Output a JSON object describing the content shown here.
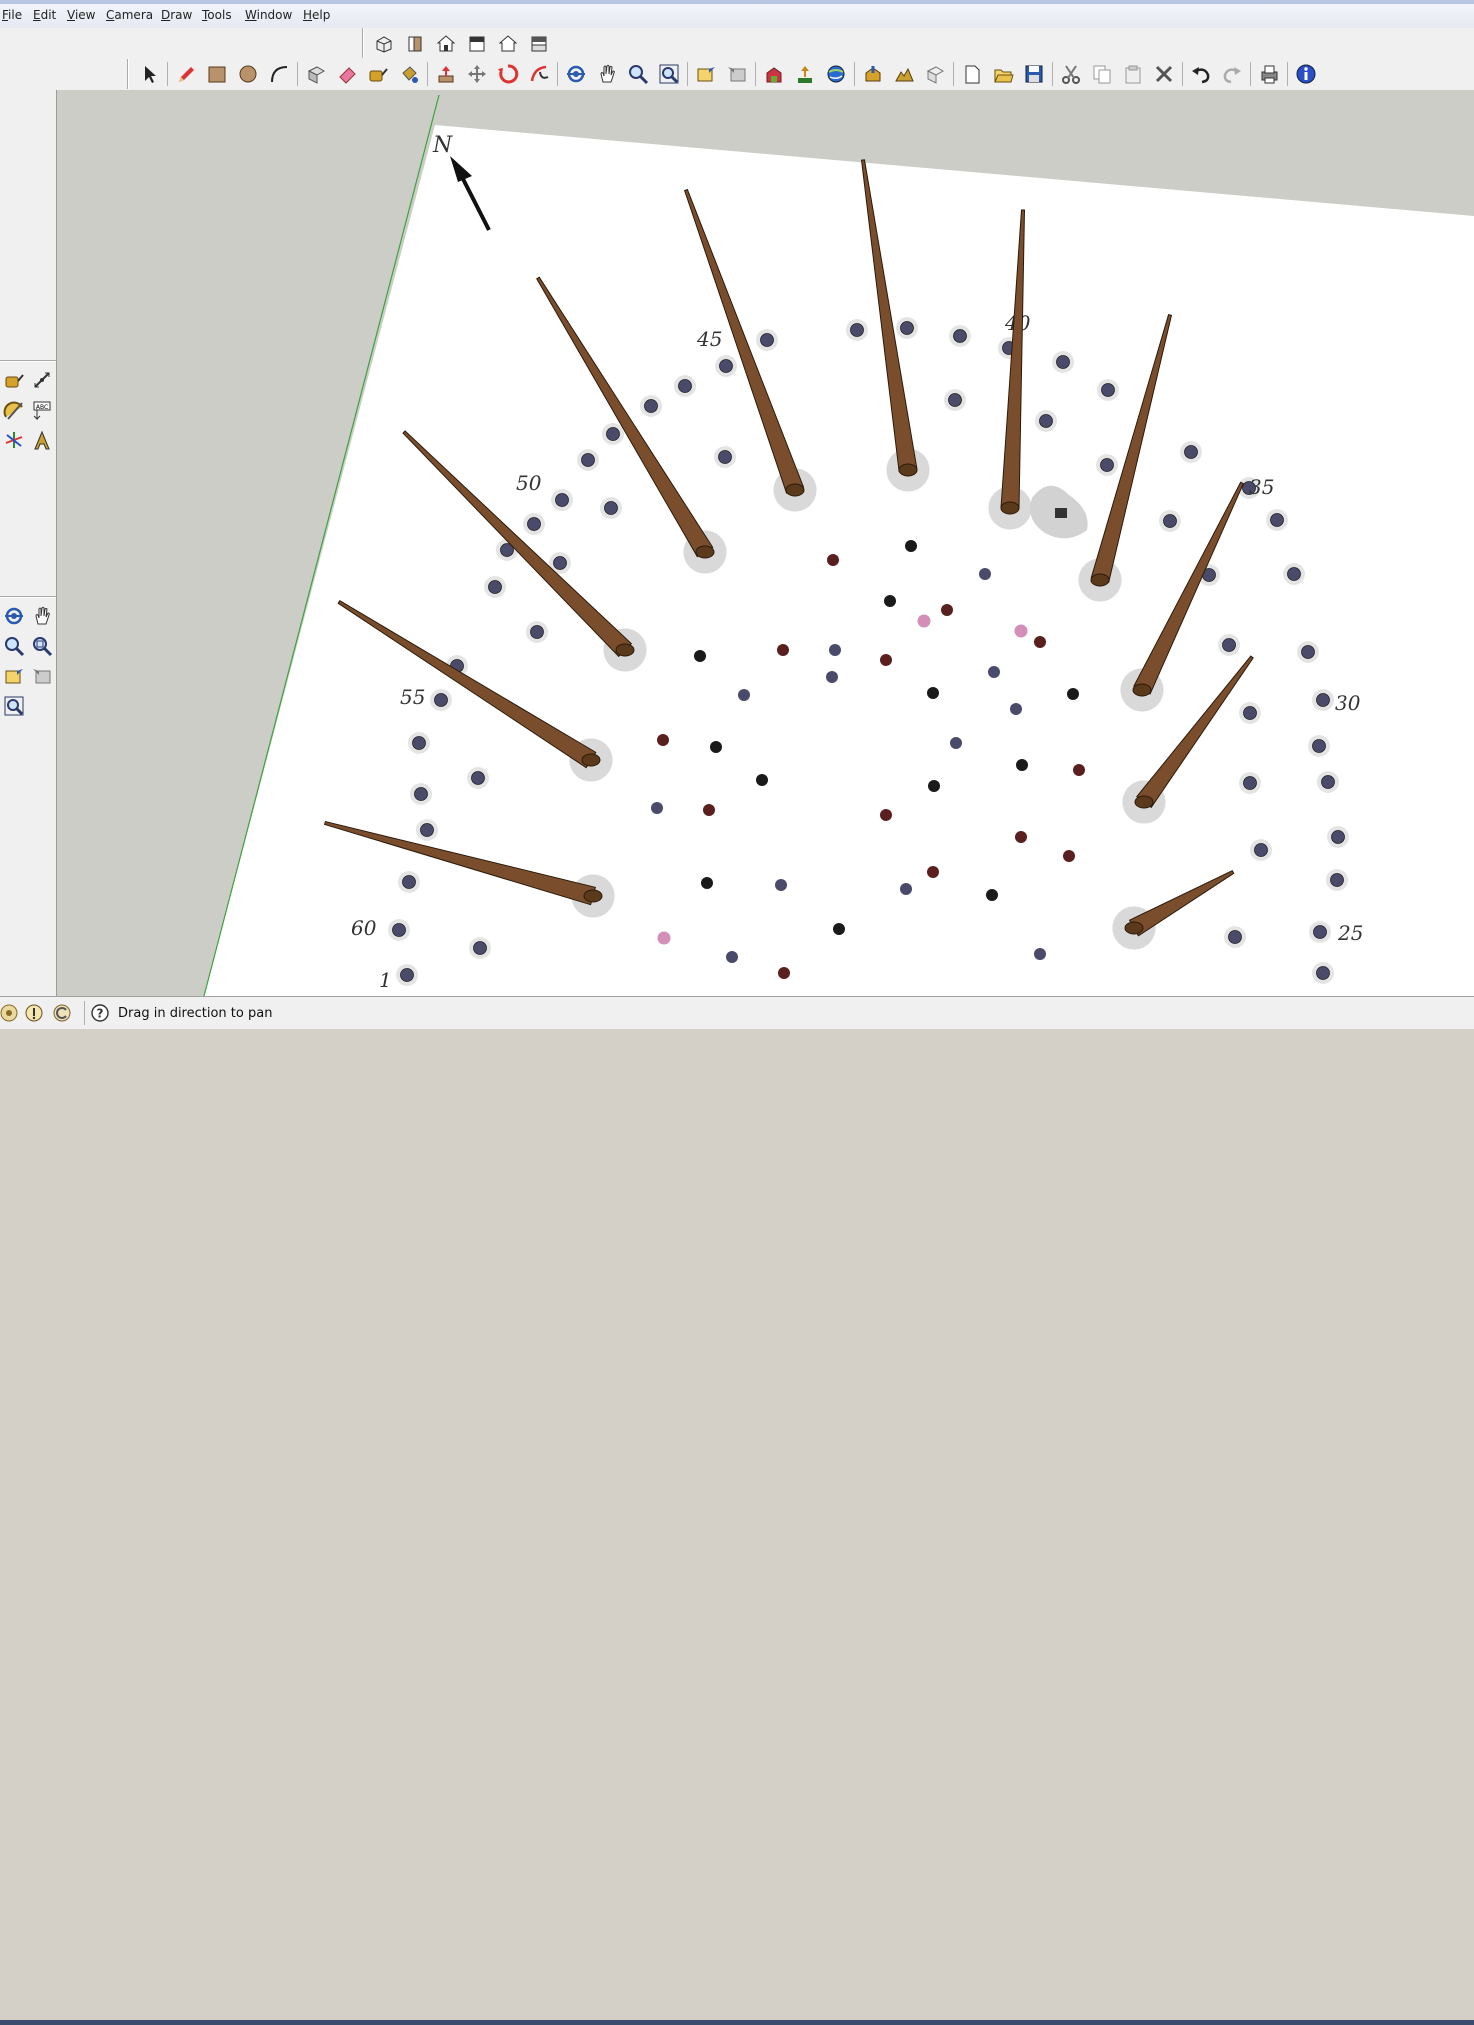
{
  "menu": {
    "items": [
      {
        "label": "File",
        "key": "F"
      },
      {
        "label": "Edit",
        "key": "E"
      },
      {
        "label": "View",
        "key": "V"
      },
      {
        "label": "Camera",
        "key": "C"
      },
      {
        "label": "Draw",
        "key": "D"
      },
      {
        "label": "Tools",
        "key": "T"
      },
      {
        "label": "Window",
        "key": "W"
      },
      {
        "label": "Help",
        "key": "H"
      }
    ]
  },
  "views_toolbar": [
    "iso-view-icon",
    "front-view-icon",
    "top-view-icon",
    "right-view-icon",
    "back-view-icon",
    "left-view-icon"
  ],
  "main_toolbar": [
    "select-arrow-icon",
    "sep",
    "pencil-icon",
    "rectangle-icon",
    "circle-icon",
    "arc-icon",
    "sep",
    "make-component-icon",
    "eraser-icon",
    "tape-measure-icon",
    "paint-bucket-icon",
    "sep",
    "push-pull-icon",
    "move-icon",
    "rotate-icon",
    "follow-me-icon",
    "sep",
    "orbit-icon",
    "pan-hand-icon",
    "zoom-icon",
    "zoom-extents-icon",
    "sep",
    "previous-view-icon",
    "next-view-icon",
    "sep",
    "get-models-icon",
    "share-model-icon",
    "google-earth-icon",
    "sep",
    "add-location-icon",
    "toggle-terrain-icon",
    "photo-textures-icon",
    "sep",
    "new-file-icon",
    "open-file-icon",
    "save-icon",
    "sep",
    "cut-icon",
    "copy-icon",
    "paste-icon",
    "delete-icon",
    "sep",
    "undo-icon",
    "redo-icon",
    "sep",
    "print-icon",
    "sep",
    "model-info-icon"
  ],
  "left_toolbar": {
    "group1": [
      "tape-measure-icon",
      "dimension-icon",
      "protractor-icon",
      "text-label-icon",
      "axes-icon",
      "3d-text-icon"
    ],
    "group2": [
      "orbit-icon",
      "pan-hand-icon",
      "zoom-icon",
      "zoom-window-icon",
      "previous-view-icon",
      "next-view-icon",
      "zoom-extents-icon"
    ]
  },
  "scene": {
    "north_label": "N",
    "plan_labels": [
      "45",
      "40",
      "35",
      "30",
      "25",
      "50",
      "55",
      "60",
      "1"
    ],
    "colors": {
      "ground": "#cbcdc6",
      "plan": "#ffffff",
      "pole": "#7a4e2d",
      "post_hole": "#4a4a6a",
      "red_hole": "#5a2020",
      "pink_hole": "#d48fb8",
      "axis_line": "#3da33d"
    }
  },
  "status": {
    "text": "Drag in direction to pan",
    "icons": [
      "geo-location-icon",
      "credits-icon",
      "sign-in-icon",
      "help-icon"
    ]
  }
}
